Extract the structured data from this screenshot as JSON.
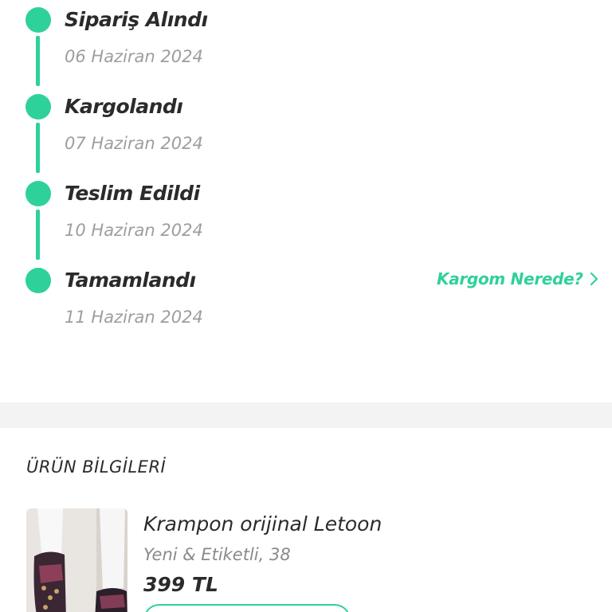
{
  "timeline": {
    "steps": [
      {
        "title": "Sipariş Alındı",
        "date": "06 Haziran 2024"
      },
      {
        "title": "Kargolandı",
        "date": "07 Haziran 2024"
      },
      {
        "title": "Teslim Edildi",
        "date": "10 Haziran 2024"
      },
      {
        "title": "Tamamlandı",
        "date": "11 Haziran 2024"
      }
    ],
    "track_link": {
      "label": "Kargom Nerede?",
      "icon": "chevron-right-icon"
    }
  },
  "product_section": {
    "title": "ÜRÜN BİLGİLERİ",
    "product": {
      "name": "Krampon orijinal Letoon",
      "detail": "Yeni & Etiketli, 38",
      "price": "399 TL",
      "image": "football-boots-photo"
    }
  },
  "colors": {
    "accent": "#2ed19a",
    "text": "#2b2b2b",
    "muted": "#9e9e9e",
    "divider": "#f3f3f3"
  }
}
